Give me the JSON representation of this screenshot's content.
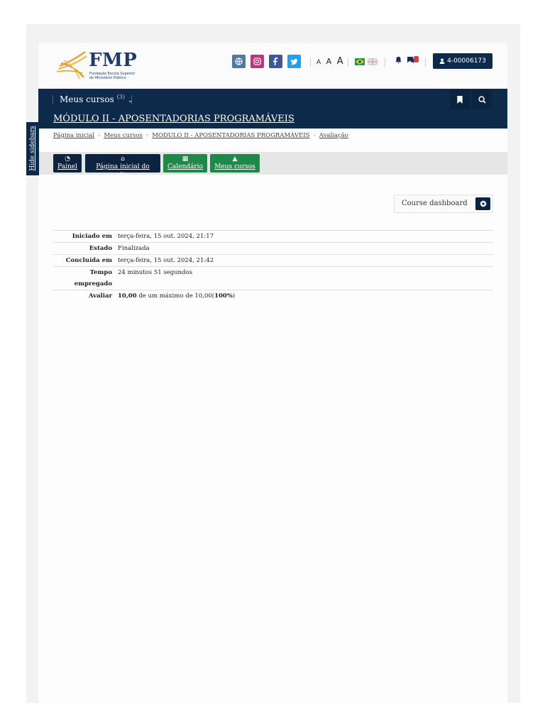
{
  "logo": {
    "name": "FMP",
    "subtitle_line1": "Fundação Escola Superior",
    "subtitle_line2": "do Ministério Público"
  },
  "header": {
    "font_sizes": [
      "A",
      "A",
      "A"
    ],
    "user_id": "4-00006173"
  },
  "colors": {
    "navy": "#0d2a4a",
    "green": "#1e8a4a",
    "instagram": "#c2337e",
    "facebook": "#3b5998",
    "twitter": "#1da1f2",
    "globe": "#4a7aa8"
  },
  "nav": {
    "courses_label": "Meus cursos",
    "courses_count": "(3)"
  },
  "course": {
    "title": "MÓDULO II - APOSENTADORIAS PROGRAMÁVEIS"
  },
  "breadcrumb": [
    "Página inicial",
    "Meus cursos",
    "MODULO II - APOSENTADORIAS PROGRAMÁVEIS",
    "Avaliação"
  ],
  "quick_links": [
    {
      "label": "Painel",
      "icon": "dashboard-icon"
    },
    {
      "label": "Página inicial do site",
      "icon": "home-icon"
    },
    {
      "label": "Calendário",
      "icon": "calendar-icon"
    },
    {
      "label": "Meus cursos",
      "icon": "graduation-cap-icon"
    }
  ],
  "dashboard_button": {
    "label": "Course dashboard"
  },
  "summary": {
    "rows": [
      {
        "label": "Iniciado em",
        "value": "terça-feira, 15 out. 2024, 21:17"
      },
      {
        "label": "Estado",
        "value": "Finalizada"
      },
      {
        "label": "Concluída em",
        "value": "terça-feira, 15 out. 2024, 21:42"
      },
      {
        "label_line1": "Tempo",
        "label_line2": "empregado",
        "value": "24 minutos 51 segundos"
      }
    ],
    "grade": {
      "label": "Avaliar",
      "score": "10,00",
      "middle": "de um máximo de 10,00(",
      "percent": "100%",
      "end": ")"
    }
  },
  "sidebar_toggle": {
    "label": "Hide sidebars"
  }
}
